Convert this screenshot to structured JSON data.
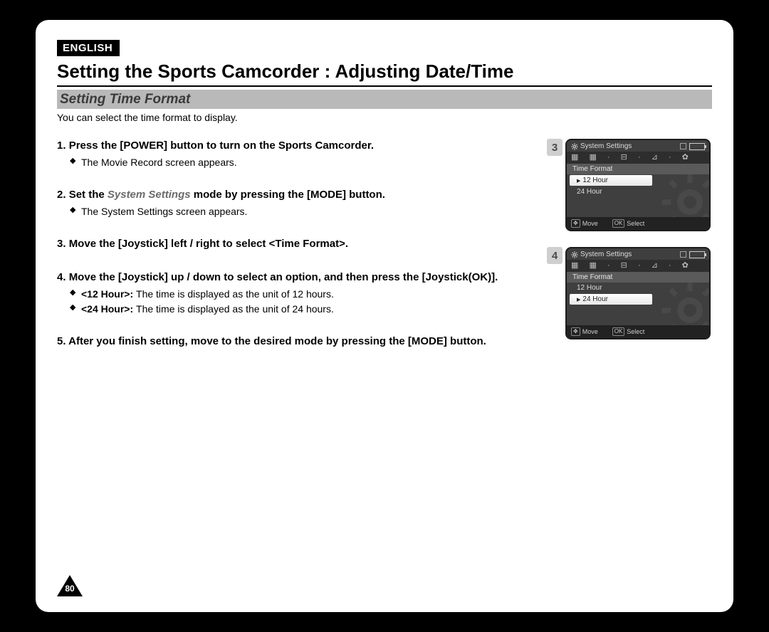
{
  "language_badge": "ENGLISH",
  "main_title": "Setting the Sports Camcorder : Adjusting Date/Time",
  "section_title": "Setting Time Format",
  "intro_text": "You can select the time format to display.",
  "steps": [
    {
      "num": "1.",
      "head_plain_before": "Press the [POWER] button to turn on the Sports Camcorder.",
      "head_em": "",
      "head_plain_after": "",
      "bullets": [
        {
          "bold": "",
          "text": "The Movie Record screen appears."
        }
      ]
    },
    {
      "num": "2.",
      "head_plain_before": "Set the ",
      "head_em": "System Settings",
      "head_plain_after": " mode by pressing the [MODE] button.",
      "bullets": [
        {
          "bold": "",
          "text": "The System Settings screen appears."
        }
      ]
    },
    {
      "num": "3.",
      "head_plain_before": "Move the [Joystick] left / right to select <Time Format>.",
      "head_em": "",
      "head_plain_after": "",
      "bullets": []
    },
    {
      "num": "4.",
      "head_plain_before": "Move the [Joystick] up / down to select an option, and then press the [Joystick(OK)].",
      "head_em": "",
      "head_plain_after": "",
      "bullets": [
        {
          "bold": "<12 Hour>: ",
          "text": "The time is displayed as the unit of 12 hours."
        },
        {
          "bold": "<24 Hour>: ",
          "text": "The time is displayed as the unit of 24 hours."
        }
      ]
    },
    {
      "num": "5.",
      "head_plain_before": "After you finish setting, move to the desired mode by pressing the [MODE] button.",
      "head_em": "",
      "head_plain_after": "",
      "bullets": []
    }
  ],
  "screens": [
    {
      "step_label": "3",
      "header": "System Settings",
      "tab": "Time Format",
      "options": [
        {
          "label": "12 Hour",
          "selected": true
        },
        {
          "label": "24 Hour",
          "selected": false
        }
      ],
      "foot_move": "Move",
      "foot_ok": "OK",
      "foot_select": "Select"
    },
    {
      "step_label": "4",
      "header": "System Settings",
      "tab": "Time Format",
      "options": [
        {
          "label": "12 Hour",
          "selected": false
        },
        {
          "label": "24 Hour",
          "selected": true
        }
      ],
      "foot_move": "Move",
      "foot_ok": "OK",
      "foot_select": "Select"
    }
  ],
  "page_number": "80",
  "icons": {
    "gear": "gear-icon",
    "battery": "battery-icon",
    "joystick": "joystick-icon"
  }
}
